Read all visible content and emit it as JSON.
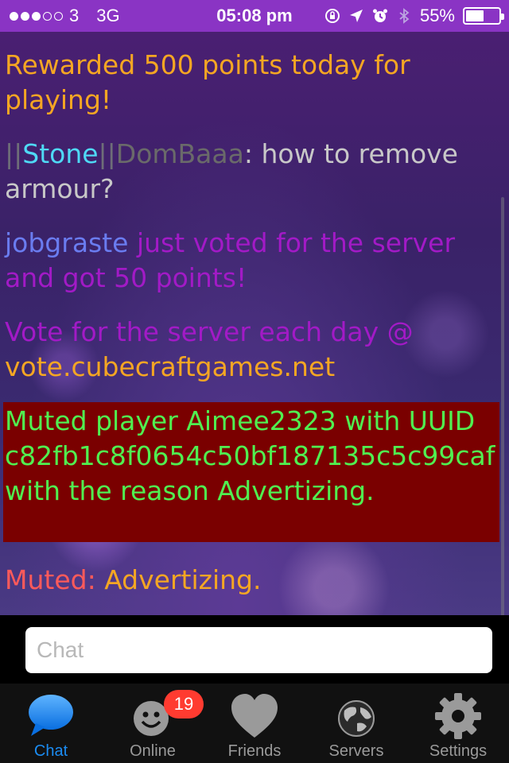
{
  "status_bar": {
    "signal_dots_filled": 3,
    "signal_dots_total": 5,
    "carrier": "3",
    "network": "3G",
    "time": "05:08 pm",
    "battery_percent": "55%",
    "battery_level": 0.55
  },
  "messages": {
    "m1": {
      "text": "Rewarded 500 points today for playing!"
    },
    "m2": {
      "p1": "||",
      "p2": "Stone",
      "p3": "||",
      "p4": "DomBaaa",
      "p5": ": how to remove armour?"
    },
    "m3": {
      "p1": "jobgraste",
      "p2": " just voted for the server and got 50 points!"
    },
    "m4": {
      "p1": "Vote for the server each day @ ",
      "p2": "vote.cubecraftgames.net"
    },
    "m5": {
      "text": "Muted player Aimee2323 with UUID c82fb1c8f0654c50bf187135c5c99caf with the reason Advertizing."
    },
    "m6": {
      "p1": "Muted: ",
      "p2": "Advertizing."
    }
  },
  "chat_input": {
    "placeholder": "Chat",
    "value": ""
  },
  "tabs": [
    {
      "label": "Chat",
      "icon": "speech-bubble-icon",
      "active": true
    },
    {
      "label": "Online",
      "icon": "smiley-icon",
      "active": false,
      "badge": "19"
    },
    {
      "label": "Friends",
      "icon": "heart-icon",
      "active": false
    },
    {
      "label": "Servers",
      "icon": "globe-icon",
      "active": false
    },
    {
      "label": "Settings",
      "icon": "gear-icon",
      "active": false
    }
  ],
  "colors": {
    "status_bar": "#8a34c4",
    "active_tab": "#1b8cf2",
    "orange": "#f5a623",
    "muted_box_bg": "#7a0000",
    "muted_box_text": "#50f050",
    "badge": "#ff3b30"
  }
}
